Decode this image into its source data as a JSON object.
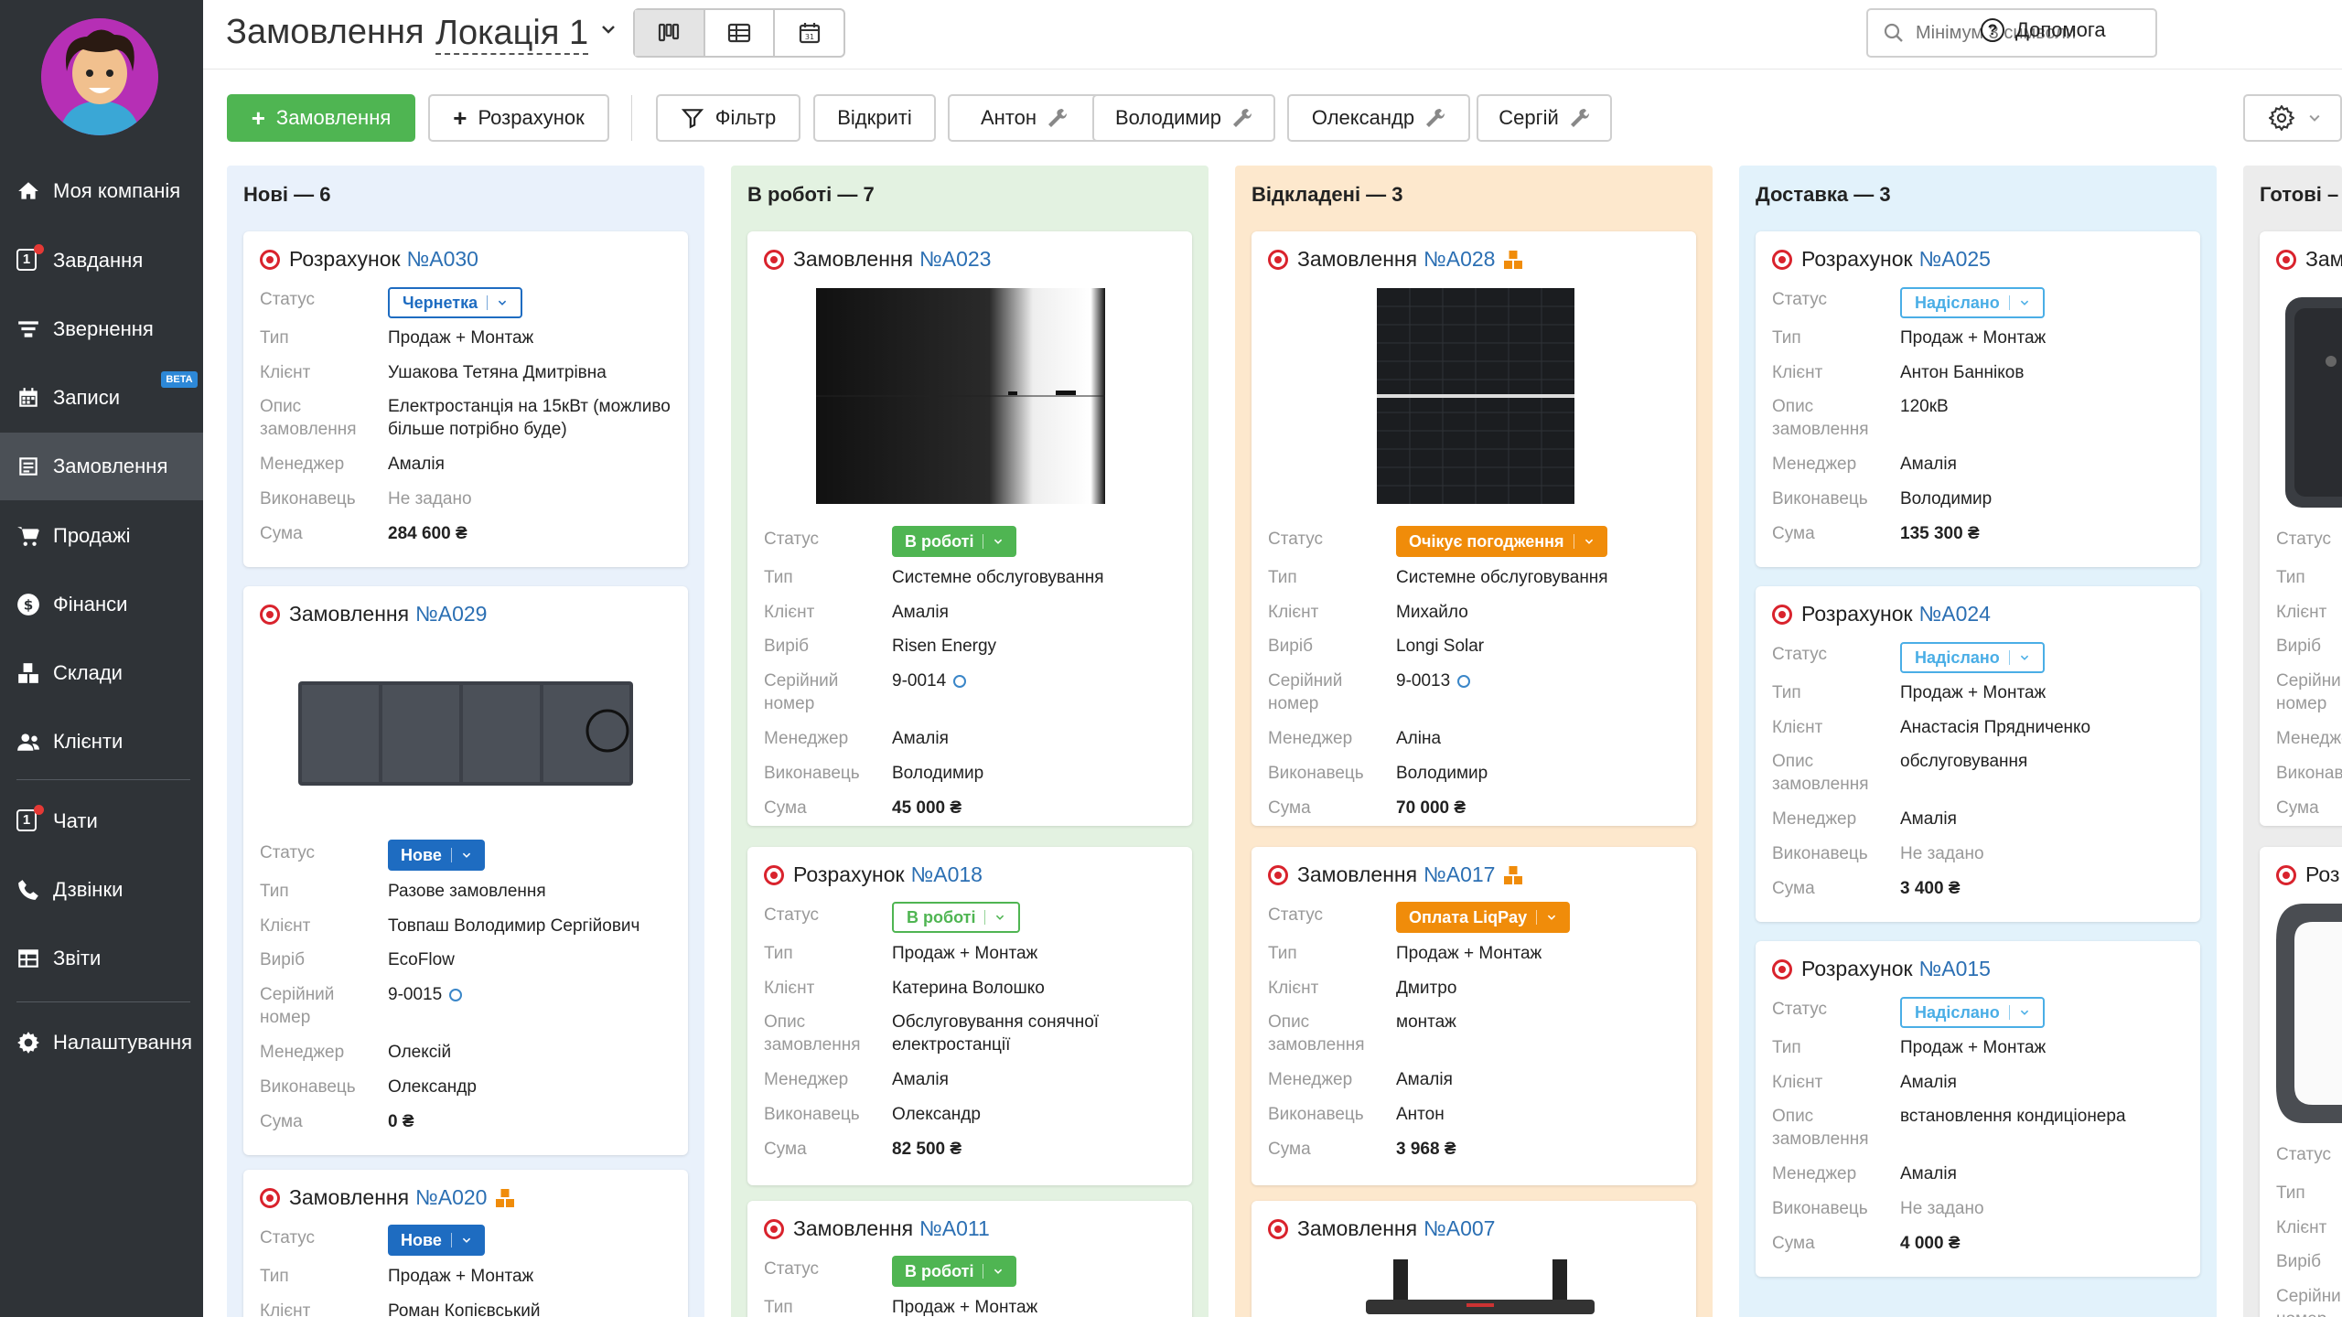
{
  "sidebar": {
    "items": [
      {
        "label": "Моя компанія"
      },
      {
        "label": "Завдання",
        "badge": "1"
      },
      {
        "label": "Звернення"
      },
      {
        "label": "Записи",
        "tag": "BETA"
      },
      {
        "label": "Замовлення"
      },
      {
        "label": "Продажі"
      },
      {
        "label": "Фінанси"
      },
      {
        "label": "Склади"
      },
      {
        "label": "Клієнти"
      },
      {
        "label": "Чати",
        "badge": "1"
      },
      {
        "label": "Дзвінки"
      },
      {
        "label": "Звіти"
      },
      {
        "label": "Налаштування"
      }
    ]
  },
  "header": {
    "title": "Замовлення",
    "location": "Локація 1",
    "search_placeholder": "Мінімум 3 символи",
    "help": "Допомога"
  },
  "toolbar": {
    "add_order": "Замовлення",
    "add_estimate": "Розрахунок",
    "filter": "Фільтр",
    "open": "Відкриті",
    "people": [
      "Антон",
      "Володимир",
      "Олександр",
      "Сергій"
    ]
  },
  "columns": [
    {
      "title": "Нові — 6"
    },
    {
      "title": "В роботі — 7"
    },
    {
      "title": "Відкладені — 3"
    },
    {
      "title": "Доставка — 3"
    },
    {
      "title": "Готові –"
    }
  ],
  "labels": {
    "status": "Статус",
    "type": "Тип",
    "client": "Клієнт",
    "desc": "Опис замовлення",
    "manager": "Менеджер",
    "executor": "Виконавець",
    "sum": "Сума",
    "product": "Виріб",
    "serial": "Серійний номер"
  },
  "cards": {
    "a030": {
      "kind": "Розрахунок",
      "num": "№A030",
      "status": "Чернетка",
      "type": "Продаж + Монтаж",
      "client": "Ушакова Тетяна Дмитрівна",
      "desc": "Електростанція на 15кВт (можливо більше потрібно буде)",
      "manager": "Амалія",
      "executor": "Не задано",
      "sum": "284 600 ₴"
    },
    "a029": {
      "kind": "Замовлення",
      "num": "№A029",
      "status": "Нове",
      "type": "Разове замовлення",
      "client": "Товпаш Володимир Сергійович",
      "product": "EcoFlow",
      "serial": "9-0015",
      "manager": "Олексій",
      "executor": "Олександр",
      "sum": "0 ₴"
    },
    "a020": {
      "kind": "Замовлення",
      "num": "№A020",
      "status": "Нове",
      "type": "Продаж + Монтаж",
      "client": "Роман Копієвський"
    },
    "a023": {
      "kind": "Замовлення",
      "num": "№A023",
      "status": "В роботі",
      "type": "Системне обслуговування",
      "client": "Амалія",
      "product": "Risen Energy",
      "serial": "9-0014",
      "manager": "Амалія",
      "executor": "Володимир",
      "sum": "45 000 ₴"
    },
    "a018": {
      "kind": "Розрахунок",
      "num": "№A018",
      "status": "В роботі",
      "type": "Продаж + Монтаж",
      "client": "Катерина Волошко",
      "desc": "Обслуговування сонячної електростанції",
      "manager": "Амалія",
      "executor": "Олександр",
      "sum": "82 500 ₴"
    },
    "a011": {
      "kind": "Замовлення",
      "num": "№A011",
      "status": "В роботі",
      "type": "Продаж + Монтаж"
    },
    "a028": {
      "kind": "Замовлення",
      "num": "№A028",
      "status": "Очікує погодження",
      "type": "Системне обслуговування",
      "client": "Михайло",
      "product": "Longi Solar",
      "serial": "9-0013",
      "manager": "Аліна",
      "executor": "Володимир",
      "sum": "70 000 ₴"
    },
    "a017": {
      "kind": "Замовлення",
      "num": "№A017",
      "status": "Оплата LiqPay",
      "type": "Продаж + Монтаж",
      "client": "Дмитро",
      "desc": "монтаж",
      "manager": "Амалія",
      "executor": "Антон",
      "sum": "3 968 ₴"
    },
    "a007": {
      "kind": "Замовлення",
      "num": "№A007"
    },
    "a025": {
      "kind": "Розрахунок",
      "num": "№A025",
      "status": "Надіслано",
      "type": "Продаж + Монтаж",
      "client": "Антон Банніков",
      "desc": "120кВ",
      "manager": "Амалія",
      "executor": "Володимир",
      "sum": "135 300 ₴"
    },
    "a024": {
      "kind": "Розрахунок",
      "num": "№A024",
      "status": "Надіслано",
      "type": "Продаж + Монтаж",
      "client": "Анастасія Прядниченко",
      "desc": "обслуговування",
      "manager": "Амалія",
      "executor": "Не задано",
      "sum": "3 400 ₴"
    },
    "a015": {
      "kind": "Розрахунок",
      "num": "№A015",
      "status": "Надіслано",
      "type": "Продаж + Монтаж",
      "client": "Амалія",
      "desc": "встановлення кондиціонера",
      "manager": "Амалія",
      "executor": "Не задано",
      "sum": "4 000 ₴"
    },
    "g1": {
      "kind": "Зам"
    },
    "g2": {
      "kind": "Роз"
    }
  },
  "colors": {
    "sidebar": "#2f3337",
    "accent_green": "#4fb552",
    "link_blue": "#2b6fb3",
    "col_new": "#e9f1fb",
    "col_work": "#e3f2e1",
    "col_postponed": "#fde8cd",
    "col_delivery": "#e2f2fb",
    "col_done": "#ececec"
  }
}
